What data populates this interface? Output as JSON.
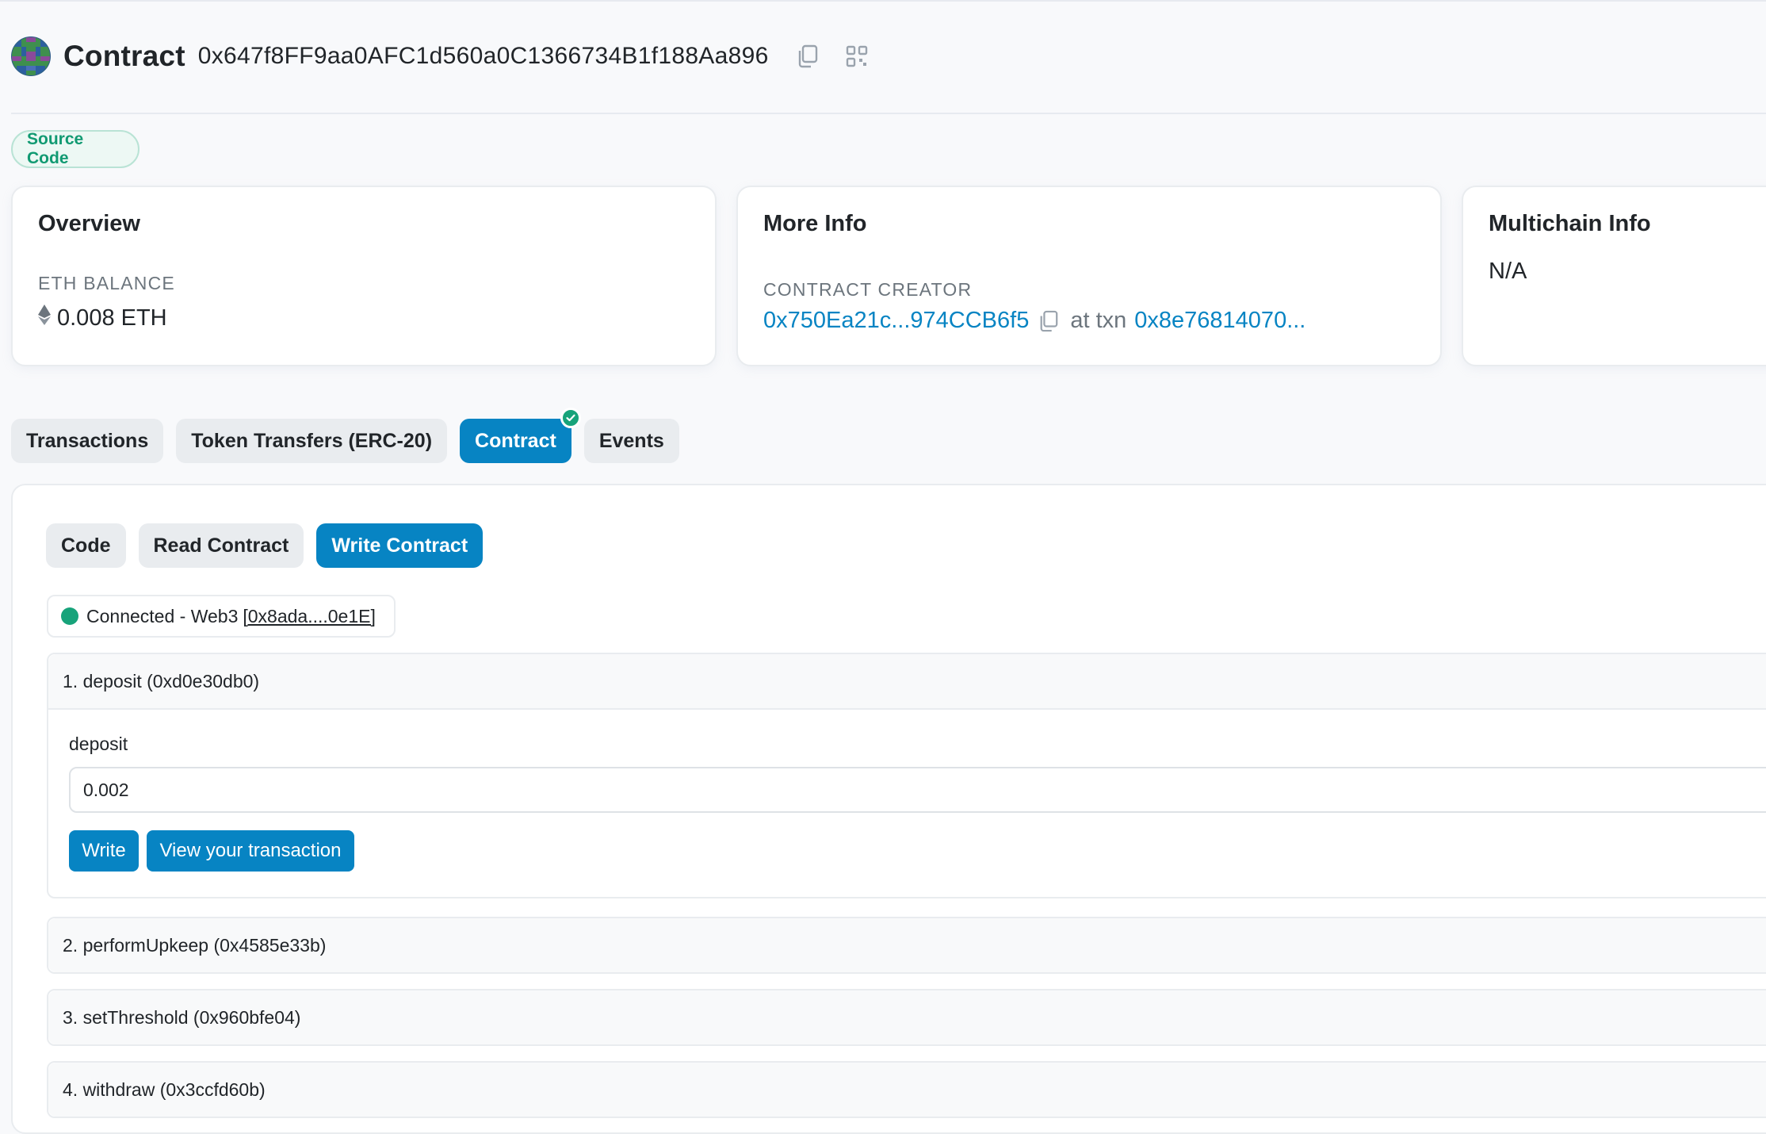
{
  "header": {
    "title": "Contract",
    "address": "0x647f8FF9aa0AFC1d560a0C1366734B1f188Aa896"
  },
  "badge": "Source Code",
  "overview": {
    "title": "Overview",
    "balance_label": "ETH BALANCE",
    "balance_value": "0.008 ETH"
  },
  "more_info": {
    "title": "More Info",
    "creator_label": "CONTRACT CREATOR",
    "creator_address": "0x750Ea21c...974CCB6f5",
    "at_txn": "at txn",
    "txn_hash": "0x8e76814070..."
  },
  "multichain": {
    "title": "Multichain Info",
    "value": "N/A"
  },
  "tabs": [
    {
      "label": "Transactions"
    },
    {
      "label": "Token Transfers (ERC-20)"
    },
    {
      "label": "Contract"
    },
    {
      "label": "Events"
    }
  ],
  "subtabs": [
    {
      "label": "Code"
    },
    {
      "label": "Read Contract"
    },
    {
      "label": "Write Contract"
    }
  ],
  "connection": {
    "status": "Connected - Web3",
    "wallet": "[0x8ada....0e1E]"
  },
  "functions": [
    {
      "label": "1. deposit (0xd0e30db0)",
      "field_label": "deposit",
      "field_value": "0.002",
      "write_label": "Write",
      "view_label": "View your transaction"
    },
    {
      "label": "2. performUpkeep (0x4585e33b)"
    },
    {
      "label": "3. setThreshold (0x960bfe04)"
    },
    {
      "label": "4. withdraw (0x3ccfd60b)"
    }
  ],
  "colors": {
    "accent": "#0784c3",
    "success": "#17a37a"
  }
}
